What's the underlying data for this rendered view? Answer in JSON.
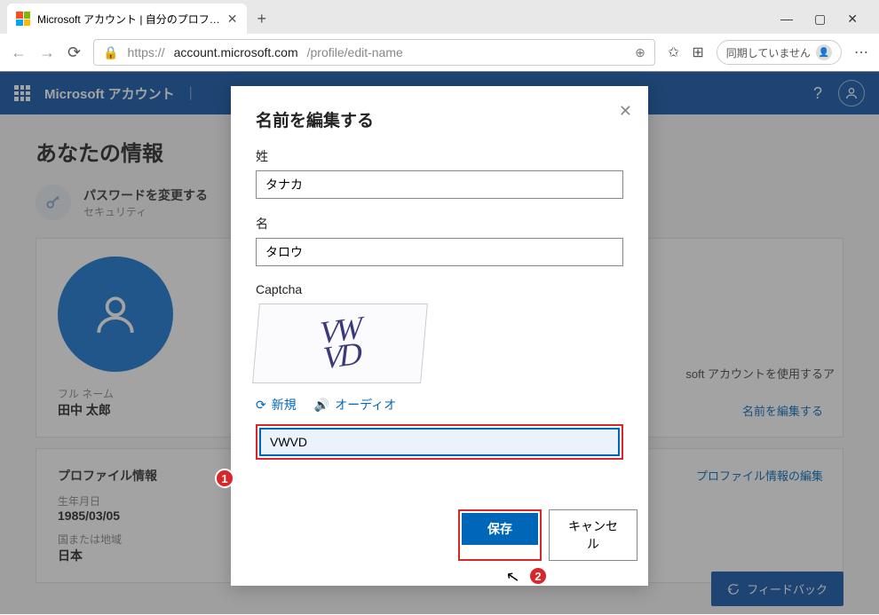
{
  "browser": {
    "tab_title": "Microsoft アカウント | 自分のプロフ…",
    "url_host": "account.microsoft.com",
    "url_path": "/profile/edit-name",
    "sync_label": "同期していません"
  },
  "header": {
    "brand": "Microsoft アカウント"
  },
  "page": {
    "title": "あなたの情報",
    "password_change": {
      "title": "パスワードを変更する",
      "subtitle": "セキュリティ"
    },
    "account_desc": "soft アカウントを使用するア",
    "full_name_label": "フル ネーム",
    "full_name_value": "田中 太郎",
    "edit_name_link": "名前を編集する",
    "profile_info_title": "プロファイル情報",
    "profile_info_edit": "プロファイル情報の編集",
    "birth_label": "生年月日",
    "birth_value": "1985/03/05",
    "country_label": "国または地域",
    "country_value": "日本",
    "feedback": "フィードバック"
  },
  "modal": {
    "title": "名前を編集する",
    "surname_label": "姓",
    "surname_value": "タナカ",
    "given_label": "名",
    "given_value": "タロウ",
    "captcha_label": "Captcha",
    "captcha_image_text": "VW\nVD",
    "new_link": "新規",
    "audio_link": "オーディオ",
    "captcha_value": "VWVD",
    "save_label": "保存",
    "cancel_label": "キャンセル"
  },
  "annotations": {
    "badge1": "1",
    "badge2": "2"
  }
}
